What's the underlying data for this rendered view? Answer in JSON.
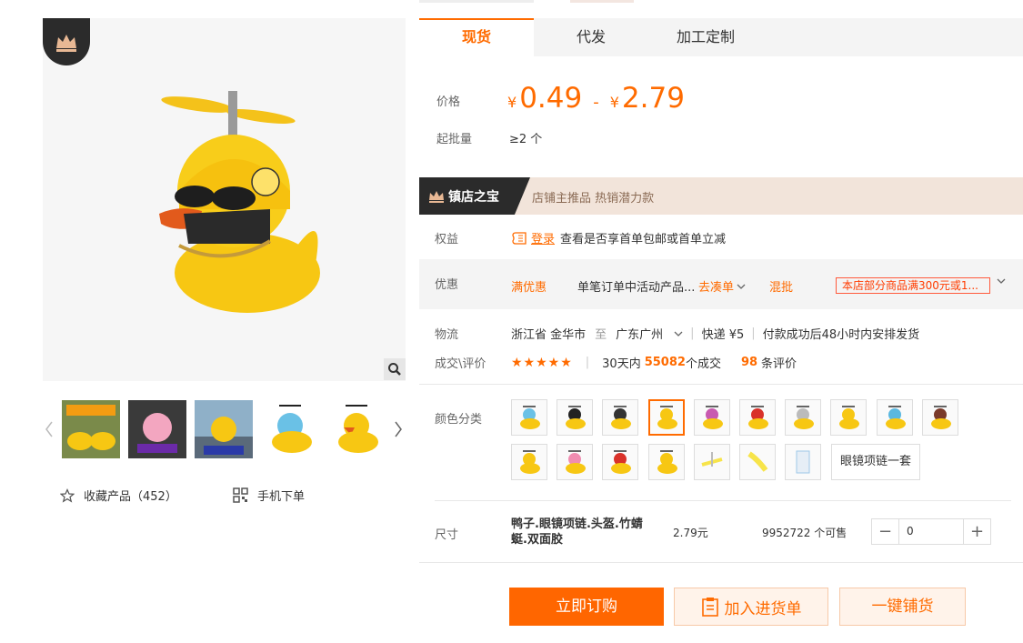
{
  "tabs": [
    {
      "label": "现货",
      "active": true
    },
    {
      "label": "代发",
      "active": false
    },
    {
      "label": "加工定制",
      "active": false
    }
  ],
  "price": {
    "label": "价格",
    "currency": "¥",
    "min": "0.49",
    "dash": "-",
    "max": "2.79",
    "moq_label": "起批量",
    "moq_value": "≥2 个"
  },
  "banner": {
    "title": "镇店之宝",
    "tags": "店铺主推品  热销潜力款"
  },
  "benefit": {
    "label": "权益",
    "login_text": "登录",
    "text": "查看是否享首单包邮或首单立减"
  },
  "discount": {
    "label": "优惠",
    "tag": "满优惠",
    "desc": "单笔订单中活动产品...",
    "link": "去凑单",
    "mix": "混批",
    "promo": "本店部分商品满300元或1..."
  },
  "logistics": {
    "label": "物流",
    "from": "浙江省 金华市",
    "to_word": "至",
    "to": "广东广州",
    "express": "快递 ¥5",
    "ship": "付款成功后48小时内安排发货"
  },
  "rating": {
    "label": "成交\\评价",
    "stars": "★★★★★",
    "deals_prefix": "30天内",
    "deals": "55082",
    "deals_suffix": "个成交",
    "reviews": "98",
    "reviews_suffix": "条评价"
  },
  "colors": {
    "label": "颜色分类",
    "text_option": "眼镜项链一套",
    "selected_index": 3
  },
  "size": {
    "label": "尺寸",
    "name": "鸭子.眼镜项链.头盔.竹蜻蜓.双面胶",
    "price": "2.79元",
    "stock": "9952722 个可售",
    "qty": "0",
    "minus": "−",
    "plus": "+"
  },
  "actions": {
    "order": "立即订购",
    "cart": "加入进货单",
    "stock": "一键铺货"
  },
  "left": {
    "collect": "收藏产品（452）",
    "mobile": "手机下单"
  },
  "accent": "#ff6b00"
}
